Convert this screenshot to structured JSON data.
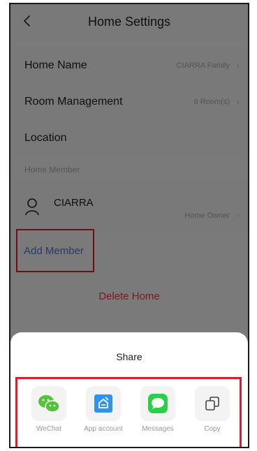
{
  "header": {
    "title": "Home Settings",
    "back_icon": "chevron-left-icon"
  },
  "rows": [
    {
      "label": "Home Name",
      "value": "CIARRA Family"
    },
    {
      "label": "Room Management",
      "value": "6 Room(s)"
    },
    {
      "label": "Location",
      "value": ""
    }
  ],
  "members": {
    "section_label": "Home Member",
    "list": [
      {
        "name": "CIARRA",
        "role": "Home Owner"
      }
    ],
    "add_label": "Add Member"
  },
  "delete_label": "Delete Home",
  "share": {
    "title": "Share",
    "items": [
      {
        "label": "WeChat",
        "icon": "wechat-icon",
        "color": "#53c33b"
      },
      {
        "label": "App account",
        "icon": "app-account-icon",
        "color": "#2e92f0"
      },
      {
        "label": "Messages",
        "icon": "messages-icon",
        "color": "#2dcf4a"
      },
      {
        "label": "Copy",
        "icon": "copy-icon",
        "color": "#444444"
      }
    ]
  },
  "colors": {
    "accent_blue": "#4a74d8",
    "danger_red": "#e8393c",
    "highlight_red": "#e11d2d"
  }
}
